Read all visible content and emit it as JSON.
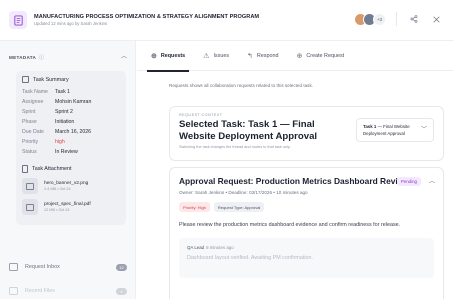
{
  "header": {
    "title": "MANUFACTURING PROCESS OPTIMIZATION & STRATEGY ALIGNMENT PROGRAM",
    "subtitle": "Updated 12 mins ago by Sarah Jenkins",
    "avatar_more": "+3"
  },
  "sidebar": {
    "title": "METADATA",
    "summary": {
      "heading": "Task Summary",
      "rows": [
        {
          "key": "Task Name",
          "value": "Task 1"
        },
        {
          "key": "Assignee",
          "value": "Mohsin Kamran"
        },
        {
          "key": "Sprint",
          "value": "Sprint 2"
        },
        {
          "key": "Phase",
          "value": "Initiation"
        },
        {
          "key": "Due Date",
          "value": "March 16, 2026"
        },
        {
          "key": "Priority",
          "value": "high"
        },
        {
          "key": "Status",
          "value": "In Review"
        }
      ]
    },
    "attachments": {
      "heading": "Task Attachment",
      "files": [
        {
          "name": "hero_banner_v2.png",
          "meta": "2.4 MB • Oct 24"
        },
        {
          "name": "project_spec_final.pdf",
          "meta": "12 MB • Oct 24"
        }
      ]
    },
    "nav": [
      {
        "label": "Request Inbox",
        "badge": "12"
      },
      {
        "label": "Recent Files",
        "badge": "4"
      }
    ]
  },
  "tabs": [
    {
      "label": "Requests",
      "icon": "plus-circle-icon"
    },
    {
      "label": "Issues",
      "icon": "warning-icon"
    },
    {
      "label": "Respond",
      "icon": "reply-icon"
    },
    {
      "label": "Create Request",
      "icon": "plus-circle-icon"
    }
  ],
  "main": {
    "description": "Requests shows all collaboration requests related to this selected task.",
    "selector": {
      "label": "REQUEST CONTEXT",
      "title": "Selected Task: Task 1 — Final Website Deployment Approval",
      "hint": "Switching the task changes the thread and routes to that task only.",
      "dropdown_bold": "Task 1",
      "dropdown_rest": " — Final Website Deployment Approval"
    },
    "request": {
      "title": "Approval Request: Production Metrics Dashboard Review",
      "status": "Pending",
      "meta": "Owner: Sarah Jenkins  •  Deadline: 03/17/2026  •  10 minutes ago",
      "priority_chip": "Priority: High",
      "type_chip": "Request Type: Approval",
      "body": "Please review the production metrics dashboard evidence and confirm readiness for release.",
      "comment_author": "QA Lead",
      "comment_time": "8 minutes ago",
      "comment_text": "Dashboard layout verified. Awaiting PM confirmation."
    }
  },
  "colors": {
    "accent": "#1f2430",
    "priority_high": "#e0454a",
    "pending": "#8a3fc8"
  }
}
